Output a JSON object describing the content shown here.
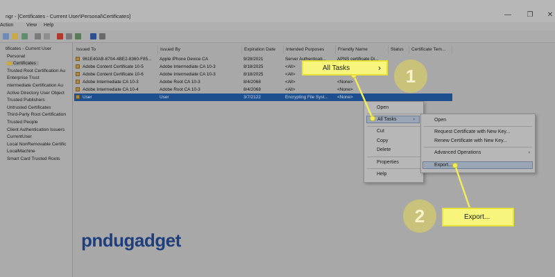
{
  "window": {
    "title": "ngr - [Certificates - Current User\\Personal\\Certificates]",
    "minimize_glyph": "—",
    "maximize_glyph": "❐",
    "close_glyph": "✕"
  },
  "menubar": [
    "Action",
    "View",
    "Help"
  ],
  "toolbar_icons": [
    "back-icon",
    "folder-icon",
    "list-icon",
    "cut-icon",
    "copy-icon",
    "delete-icon",
    "properties-icon",
    "refresh-icon",
    "help-icon",
    "view-icon"
  ],
  "sidebar": {
    "items": [
      {
        "label": "tificates - Current User",
        "selected": false
      },
      {
        "label": "Personal",
        "selected": false
      },
      {
        "label": "Certificates",
        "selected": true
      },
      {
        "label": "Trusted Root Certification Au",
        "selected": false
      },
      {
        "label": "Enterprise Trust",
        "selected": false
      },
      {
        "label": "ntermediate Certification Au",
        "selected": false
      },
      {
        "label": "Active Directory User Object",
        "selected": false
      },
      {
        "label": "Trusted Publishers",
        "selected": false
      },
      {
        "label": "Untrusted Certificates",
        "selected": false
      },
      {
        "label": "Third-Party Root Certification",
        "selected": false
      },
      {
        "label": "Trusted People",
        "selected": false
      },
      {
        "label": "Client Authentication Issuers",
        "selected": false
      },
      {
        "label": "CurrentUser",
        "selected": false
      },
      {
        "label": "Local NonRemovable Certific",
        "selected": false
      },
      {
        "label": "LocalMachine",
        "selected": false
      },
      {
        "label": "Smart Card Trusted Roots",
        "selected": false
      }
    ]
  },
  "table": {
    "columns": [
      "Issued To",
      "Issued By",
      "Expiration Date",
      "Intended Purposes",
      "Friendly Name",
      "Status",
      "Certificate Tem..."
    ],
    "rows": [
      {
        "cells": [
          "961E40AB-8704-4BE2-8360-F85...",
          "Apple iPhone Device CA",
          "9/28/2021",
          "Server Authenticati...",
          "APNS certificate Di...",
          "",
          ""
        ],
        "selected": false
      },
      {
        "cells": [
          "Adobe Content Certificate 10-5",
          "Adobe Intermediate CA 10-3",
          "8/18/2025",
          "<All>",
          "",
          "",
          ""
        ],
        "selected": false
      },
      {
        "cells": [
          "Adobe Content Certificate 10-6",
          "Adobe Intermediate CA 10-3",
          "8/18/2025",
          "<All>",
          "",
          "",
          ""
        ],
        "selected": false
      },
      {
        "cells": [
          "Adobe Intermediate CA 10-3",
          "Adobe Root CA 10-3",
          "8/4/2068",
          "<All>",
          "<None>",
          "",
          ""
        ],
        "selected": false
      },
      {
        "cells": [
          "Adobe Intermediate CA 10-4",
          "Adobe Root CA 10-3",
          "8/4/2068",
          "<All>",
          "<None>",
          "",
          ""
        ],
        "selected": false
      },
      {
        "cells": [
          "User",
          "User",
          "3/7/2122",
          "Encrypting File Syst...",
          "<None>",
          "",
          ""
        ],
        "selected": true
      }
    ]
  },
  "context_menu": {
    "items": [
      "Open",
      "All Tasks",
      "Cut",
      "Copy",
      "Delete",
      "Properties",
      "Help"
    ],
    "arrow": "›"
  },
  "submenu": {
    "items": [
      "Open",
      "Request Certificate with New Key...",
      "Renew Certificate with New Key...",
      "Advanced Operations",
      "Export..."
    ],
    "arrow": "›"
  },
  "callouts": {
    "all_tasks_label": "All Tasks",
    "all_tasks_arrow": "›",
    "export_label": "Export...",
    "step1": "1",
    "step2": "2"
  },
  "logo": {
    "part1": "pndu",
    "part2": "gadget",
    "color1": "#1e3e7e",
    "color2": "#1e3e7e",
    "accent": "#7bbfe4"
  },
  "colors": {
    "callout_fill": "#f7f57c",
    "selected_row": "#1d4f8e",
    "badge": "#c9c27a"
  }
}
